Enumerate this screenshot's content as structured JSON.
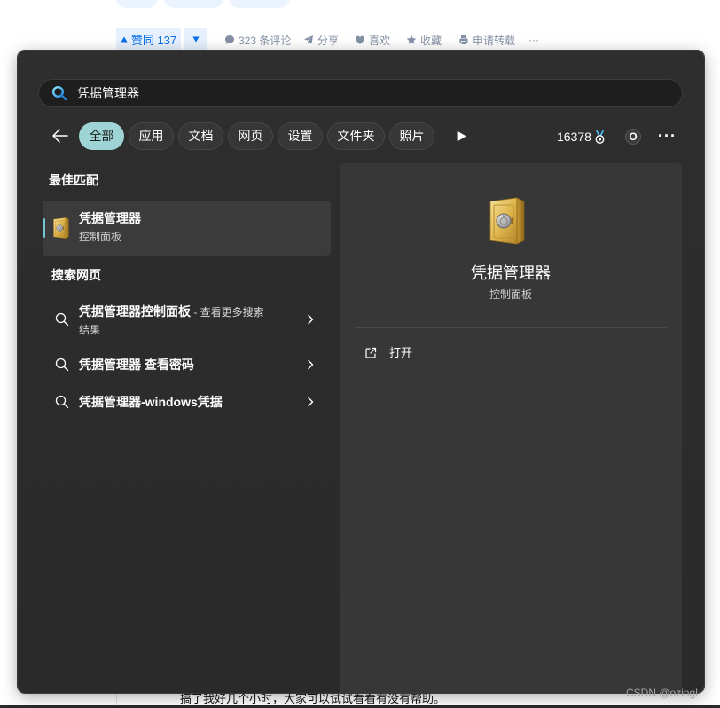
{
  "colors": {
    "accent": "#9fd4d6",
    "accent_bar": "#76c4cb",
    "panel_bg": "#2b2b2b",
    "preview_bg": "#373737",
    "selected_bg": "#3b3b3b",
    "zhihu_blue": "#056de8",
    "meta_gray": "#8590a6"
  },
  "answer_actions": {
    "vote_up": {
      "icon": "triangle-up-icon",
      "label": "赞同 137"
    },
    "vote_down": {
      "icon": "triangle-down-icon"
    },
    "comments": {
      "icon": "comment-icon",
      "label": "323 条评论"
    },
    "share": {
      "icon": "share-icon",
      "label": "分享"
    },
    "like": {
      "icon": "heart-icon",
      "label": "喜欢"
    },
    "favorite": {
      "icon": "star-icon",
      "label": "收藏"
    },
    "reprint": {
      "icon": "document-icon",
      "label": "申请转载"
    },
    "more": "···"
  },
  "search": {
    "icon": "search-icon",
    "query": "凭据管理器",
    "back_icon": "arrow-left-icon",
    "filters": [
      {
        "label": "全部",
        "selected": true
      },
      {
        "label": "应用",
        "selected": false
      },
      {
        "label": "文档",
        "selected": false
      },
      {
        "label": "网页",
        "selected": false
      },
      {
        "label": "设置",
        "selected": false
      },
      {
        "label": "文件夹",
        "selected": false
      },
      {
        "label": "照片",
        "selected": false
      }
    ],
    "play_icon": "play-icon",
    "points": "16378",
    "points_icon": "medal-icon",
    "avatar_initial": "O",
    "more": "···"
  },
  "best_match": {
    "heading": "最佳匹配",
    "icon": "credential-manager-safe-icon",
    "title": "凭据管理器",
    "subtitle": "控制面板"
  },
  "web_search": {
    "heading": "搜索网页",
    "results": [
      {
        "icon": "search-icon",
        "title": "凭据管理器控制面板",
        "suffix": " - 查看更多搜索结果"
      },
      {
        "icon": "search-icon",
        "title": "凭据管理器 查看密码"
      },
      {
        "icon": "search-icon",
        "title": "凭据管理器-windows凭据"
      }
    ]
  },
  "preview": {
    "icon": "credential-manager-safe-icon",
    "title": "凭据管理器",
    "subtitle": "控制面板",
    "actions": [
      {
        "icon": "open-external-icon",
        "label": "打开"
      }
    ]
  },
  "article": {
    "text": "搞了我好几个小时，大家可以试试看看有没有帮助。"
  },
  "watermark": "CSDN @ozingl"
}
